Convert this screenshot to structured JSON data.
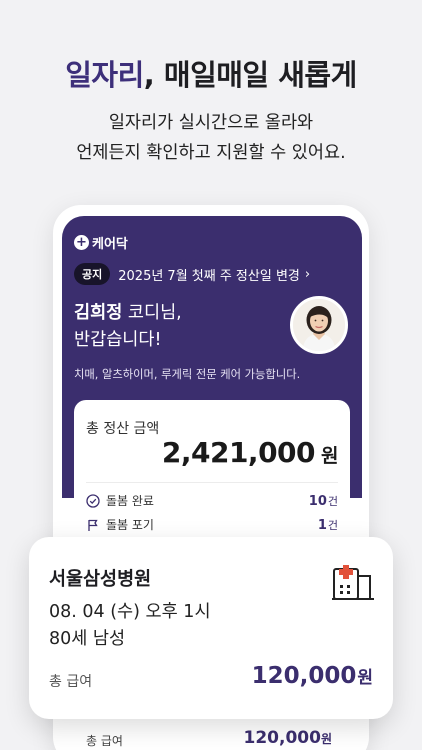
{
  "headline": {
    "accent": "일자리",
    "rest": ", 매일매일 새롭게"
  },
  "subtitle": {
    "line1": "일자리가 실시간으로 올라와",
    "line2": "언제든지 확인하고 지원할 수 있어요."
  },
  "app": {
    "brand": "케어닥",
    "notice": {
      "badge": "공지",
      "text": "2025년 7월 첫째 주 정산일 변경",
      "chevron": "›"
    },
    "greeting": {
      "name": "김희정",
      "suffix": " 코디님,",
      "line2": "반갑습니다!"
    },
    "specialty": "치매, 알츠하이머, 루게릭 전문 케어 가능합니다.",
    "settlement": {
      "label": "총 정산 금액",
      "amount": "2,421,000",
      "unit": "원",
      "stats": [
        {
          "icon": "check-circle-icon",
          "label": "돌봄 완료",
          "count": "10",
          "unit": "건"
        },
        {
          "icon": "flag-icon",
          "label": "돌봄 포기",
          "count": "1",
          "unit": "건"
        }
      ]
    },
    "bottom_pay": {
      "label": "총 급여",
      "amount": "120,000",
      "unit": "원"
    }
  },
  "job": {
    "hospital": "서울삼성병원",
    "datetime": "08. 04 (수) 오후 1시",
    "patient": "80세 남성",
    "pay_label": "총 급여",
    "pay_amount": "120,000",
    "pay_unit": "원",
    "icon": "hospital-building-icon"
  },
  "colors": {
    "brand": "#3b2e6e",
    "accent_text": "#3d2f7a",
    "background": "#f2f2f4"
  }
}
